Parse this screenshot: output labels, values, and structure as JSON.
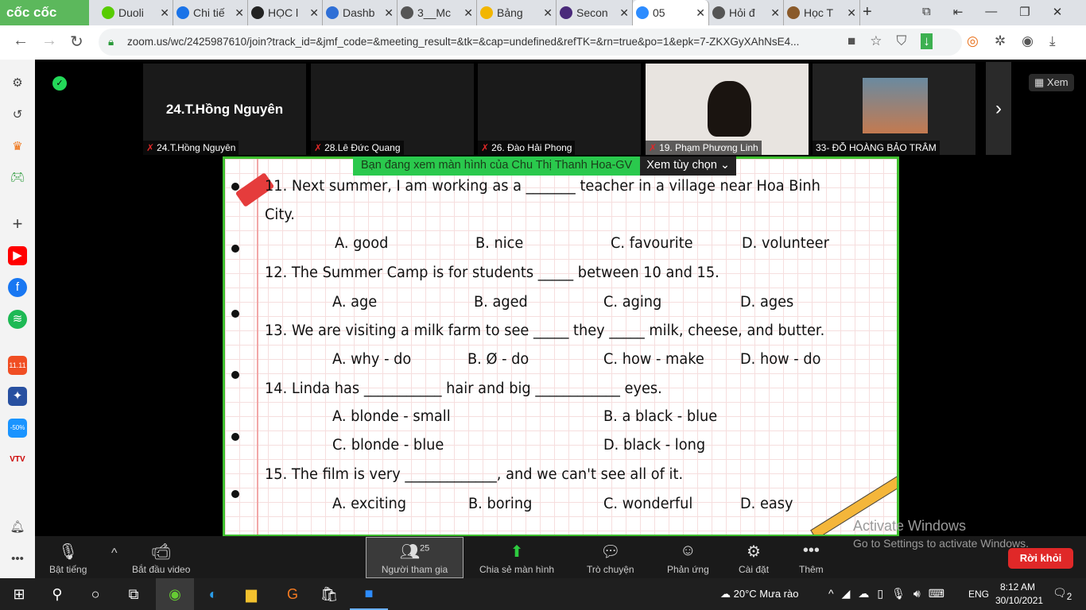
{
  "browser": {
    "brand": "cốc cốc",
    "tabs": [
      {
        "label": "Duoli",
        "color": "#58cc02"
      },
      {
        "label": "Chi tiế",
        "color": "#1a73e8"
      },
      {
        "label": "HỌC l",
        "color": "#222"
      },
      {
        "label": "Dashb",
        "color": "#2f6fd6"
      },
      {
        "label": "3__Mc",
        "color": "#555"
      },
      {
        "label": "Bảng",
        "color": "#f2b600"
      },
      {
        "label": "Secon",
        "color": "#4a2a7a"
      },
      {
        "label": "05",
        "color": "#2d8cff"
      },
      {
        "label": "Hỏi đ",
        "color": "#555"
      },
      {
        "label": "Học T",
        "color": "#8a5a2a"
      }
    ],
    "new_tab": "+",
    "url": "zoom.us/wc/2425987610/join?track_id=&jmf_code=&meeting_result=&tk=&cap=undefined&refTK=&rn=true&po=1&epk=7-ZKXGyXAhNsE4..."
  },
  "participants": [
    {
      "name": "24.T.Hồng Nguyên",
      "big": "24.T.Hồng Nguyên"
    },
    {
      "name": "28.Lê Đức Quang"
    },
    {
      "name": "26. Đào Hải Phong"
    },
    {
      "name": "19. Phạm Phương Linh"
    },
    {
      "name": "33- ĐỖ HOÀNG BẢO TRÂM"
    }
  ],
  "view_button": "Xem",
  "share_banner": {
    "text": "Bạn đang xem màn hình của Chu Thị Thanh Hoa-GV",
    "options": "Xem tùy chọn"
  },
  "worksheet": {
    "q11a": "11. Next summer, I am working as a _______ teacher in a village near Hoa Binh",
    "q11b": "City.",
    "q11opts": [
      "A. good",
      "B. nice",
      "C. favourite",
      "D. volunteer"
    ],
    "q12": "12. The Summer Camp is for students _____ between 10 and 15.",
    "q12opts": [
      "A. age",
      "B. aged",
      "C. aging",
      "D. ages"
    ],
    "q13": "13. We are visiting a milk farm to see _____ they _____ milk, cheese, and butter.",
    "q13opts": [
      "A. why - do",
      "B. Ø - do",
      "C. how - make",
      "D. how - do"
    ],
    "q14": "14. Linda has ___________ hair and big ____________ eyes.",
    "q14opts": [
      "A. blonde - small",
      "B. a black - blue",
      "C. blonde - blue",
      "D. black - long"
    ],
    "q15": "15. The film is very _____________, and we can't see all of it.",
    "q15opts": [
      "A. exciting",
      "B. boring",
      "C. wonderful",
      "D. easy"
    ]
  },
  "watermark": {
    "title": "Activate Windows",
    "sub": "Go to Settings to activate Windows."
  },
  "toolbar": {
    "mute": "Bật tiếng",
    "video": "Bắt đầu video",
    "participants": "Người tham gia",
    "participant_count": "25",
    "share": "Chia sẻ màn hình",
    "chat": "Trò chuyện",
    "react": "Phản ứng",
    "settings": "Cài đặt",
    "more": "Thêm",
    "leave": "Rời khỏi"
  },
  "taskbar": {
    "weather": "20°C  Mưa rào",
    "lang": "ENG",
    "time": "8:12 AM",
    "date": "30/10/2021",
    "notifications": "2"
  }
}
